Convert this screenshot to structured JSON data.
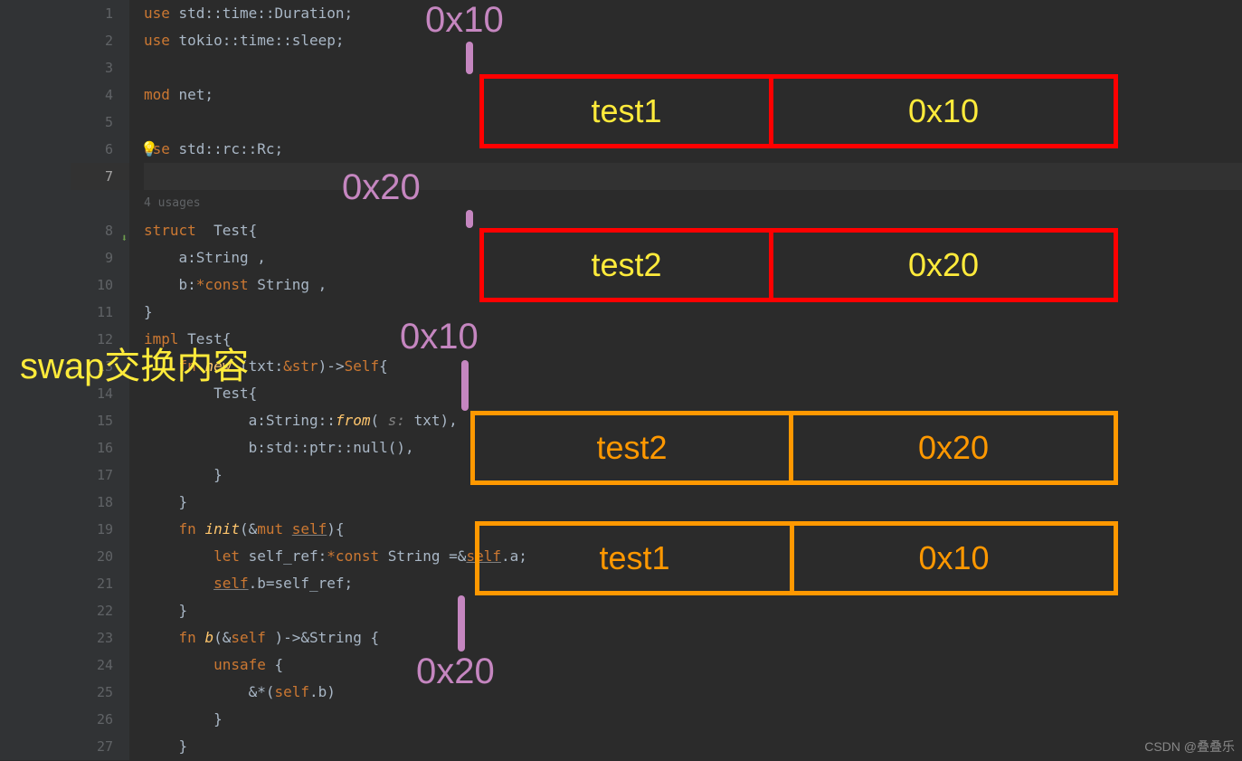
{
  "gutter": {
    "lines": [
      "1",
      "2",
      "3",
      "4",
      "5",
      "6",
      "7",
      "",
      "8",
      "9",
      "10",
      "11",
      "12",
      "13",
      "14",
      "15",
      "16",
      "17",
      "18",
      "19",
      "20",
      "21",
      "22",
      "23",
      "24",
      "25",
      "26",
      "27"
    ],
    "current": 7,
    "usages_label": "4 usages",
    "struct_icon_line": 8
  },
  "code": {
    "l1": {
      "kw": "use ",
      "path": "std::time::Duration;"
    },
    "l2": {
      "kw": "use ",
      "path": "tokio::time::sleep;"
    },
    "l4": {
      "kw": "mod ",
      "name": "net;"
    },
    "l6": {
      "kw": "use ",
      "path": "std::rc::Rc;"
    },
    "l8": {
      "kw": "struct  ",
      "name": "Test",
      "brace": "{"
    },
    "l9": {
      "field": "    a:",
      "type": "String",
      "end": " ,"
    },
    "l10": {
      "field": "    b:",
      "ptr": "*const ",
      "type": "String",
      "end": " ,"
    },
    "l11": {
      "brace": "}"
    },
    "l12": {
      "kw": "impl ",
      "name": "Test",
      "brace": "{"
    },
    "l13": {
      "kw": "    fn ",
      "fname": "new ",
      "paren": "(",
      "param": "txt:",
      "ptype": "&str",
      "paren2": ")->",
      "ret": "Self",
      "brace": "{"
    },
    "l14": {
      "text": "        Test{"
    },
    "l15": {
      "text": "            a:String::",
      "func": "from",
      "paren": "(",
      "hint": " s: ",
      "arg": "txt",
      "paren2": "),"
    },
    "l16": {
      "text": "            b:std::ptr::null(),"
    },
    "l17": {
      "text": "        }"
    },
    "l18": {
      "text": "    }"
    },
    "l19": {
      "kw": "    fn ",
      "fname": "init",
      "paren": "(&",
      "mut": "mut ",
      "self": "self",
      "paren2": "){"
    },
    "l20": {
      "kw": "        let ",
      "var": "self_ref:",
      "ptr": "*const ",
      "type": "String",
      "eq": " =&",
      "self": "self",
      "end": ".a;"
    },
    "l21": {
      "pad": "        ",
      "self": "self",
      "end": ".b=self_ref;"
    },
    "l22": {
      "text": "    }"
    },
    "l23": {
      "kw": "    fn ",
      "fname": "b",
      "paren": "(&",
      "self": "self",
      "paren2": " )->&",
      "ret": "String",
      "brace": " {"
    },
    "l24": {
      "kw": "        unsafe ",
      "brace": "{"
    },
    "l25": {
      "text": "            &*(",
      "self": "self",
      "end": ".b)"
    },
    "l26": {
      "text": "        }"
    },
    "l27": {
      "text": "    }"
    }
  },
  "diagram": {
    "addr1": "0x10",
    "addr2": "0x20",
    "addr3": "0x10",
    "addr4": "0x20",
    "swap_label": "swap交换内容",
    "box1": {
      "left": "test1",
      "right": "0x10"
    },
    "box2": {
      "left": "test2",
      "right": "0x20"
    },
    "box3": {
      "left": "test2",
      "right": "0x20"
    },
    "box4": {
      "left": "test1",
      "right": "0x10"
    }
  },
  "watermark": "CSDN @叠叠乐"
}
